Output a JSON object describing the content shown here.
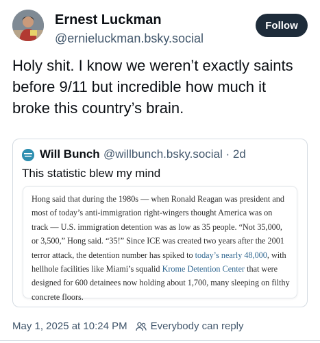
{
  "author": {
    "display_name": "Ernest Luckman",
    "handle": "@ernieluckman.bsky.social"
  },
  "actions": {
    "follow_label": "Follow"
  },
  "post": {
    "text": "Holy shit. I know we weren’t exactly saints before 9/11 but incredible how much it broke this country’s brain."
  },
  "quote": {
    "author_name": "Will Bunch",
    "author_handle_time": "@willbunch.bsky.social · 2d",
    "avatar_label": "THE BUNCH TIMES",
    "text": "This statistic blew my mind",
    "excerpt": {
      "part1": "Hong said that during the 1980s — when Ronald Reagan was president and most of today’s anti-immigration right-wingers thought America was on track — U.S. immigration detention was as low as 35 people. “Not 35,000, or 3,500,” Hong said. “35!” Since ICE was created two years after the 2001 terror attack, the detention number has spiked to ",
      "link1": "today’s nearly 48,000",
      "part2": ", with hellhole facilities like Miami’s squalid ",
      "link2": "Krome Detention Center",
      "part3": " that were designed for 600 detainees now holding about 1,700, many sleeping on filthy concrete floors."
    }
  },
  "footer": {
    "timestamp": "May 1, 2025 at 10:24 PM",
    "reply_setting": "Everybody can reply"
  },
  "colors": {
    "follow_bg": "#1e2c3a",
    "muted_text": "#42576c",
    "link": "#326891",
    "border": "#d4dbe2"
  },
  "icons": [
    "avatar-photo",
    "quote-avatar-logo",
    "people-icon"
  ]
}
